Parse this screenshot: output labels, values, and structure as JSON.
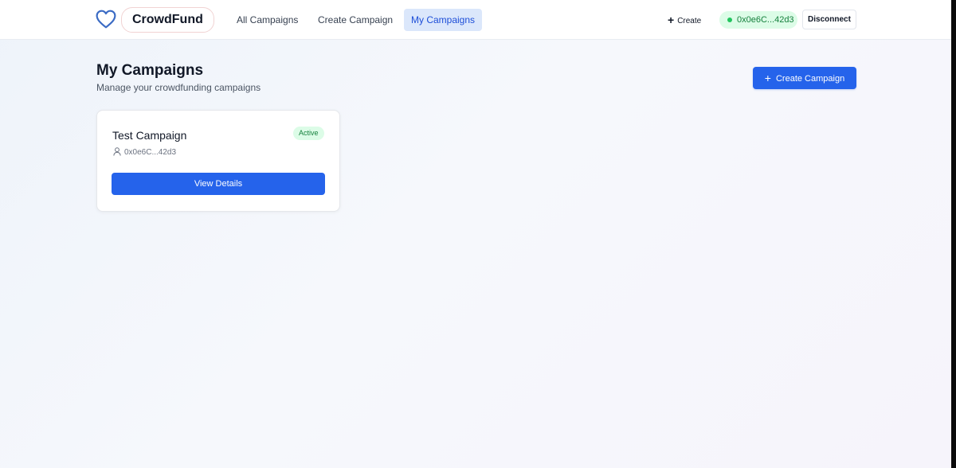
{
  "header": {
    "brand": "CrowdFund",
    "logo_icon": "heart-icon",
    "nav": [
      {
        "label": "All Campaigns",
        "active": false
      },
      {
        "label": "Create Campaign",
        "active": false
      },
      {
        "label": "My Campaigns",
        "active": true
      }
    ],
    "create_label": "Create",
    "wallet_address": "0x0e6C...42d3",
    "disconnect_label": "Disconnect"
  },
  "page": {
    "title": "My Campaigns",
    "subtitle": "Manage your crowdfunding campaigns",
    "create_button_label": "Create Campaign"
  },
  "campaigns": [
    {
      "title": "Test Campaign",
      "status": "Active",
      "owner": "0x0e6C...42d3",
      "action_label": "View Details"
    }
  ],
  "colors": {
    "accent": "#2563eb",
    "active_nav_bg": "#dbe7fb",
    "status_bg": "#dcfce7",
    "status_text": "#15803d",
    "logo": "#3b6bc4"
  }
}
